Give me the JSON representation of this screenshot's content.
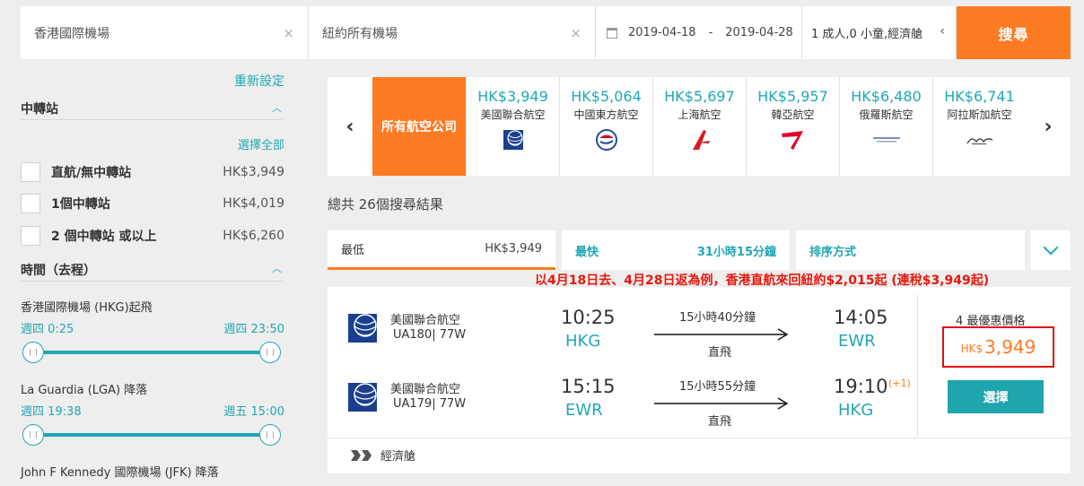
{
  "search": {
    "from": "香港國際機場",
    "to": "紐約所有機場",
    "depart_date": "2019-04-18",
    "date_separator": "-",
    "return_date": "2019-04-28",
    "passengers": "1 成人,0 小童,經濟艙",
    "clear_glyph": "×",
    "search_label": "搜尋"
  },
  "filters": {
    "reset": "重新設定",
    "stops_title": "中轉站",
    "select_all": "選擇全部",
    "stops": [
      {
        "label": "直航/無中轉站",
        "price": "HK$3,949"
      },
      {
        "label": "1個中轉站",
        "price": "HK$4,019"
      },
      {
        "label": "2 個中轉站 或以上",
        "price": "HK$6,260"
      }
    ],
    "time_title": "時間（去程）",
    "departure": {
      "label": "香港國際機場 (HKG)起飛",
      "min": "週四 0:25",
      "max": "週四 23:50"
    },
    "arrival_lga": {
      "label": "La Guardia (LGA) 降落",
      "min": "週四 19:38",
      "max": "週五 15:00"
    },
    "arrival_jfk": {
      "label": "John F Kennedy 國際機場 (JFK) 降落"
    }
  },
  "airlines": {
    "all_label": "所有航空公司",
    "items": [
      {
        "price": "HK$3,949",
        "name": "美國聯合航空",
        "icon": "united-logo-icon"
      },
      {
        "price": "HK$5,064",
        "name": "中國東方航空",
        "icon": "china-eastern-logo-icon"
      },
      {
        "price": "HK$5,697",
        "name": "上海航空",
        "icon": "shanghai-airlines-logo-icon"
      },
      {
        "price": "HK$5,957",
        "name": "韓亞航空",
        "icon": "asiana-logo-icon"
      },
      {
        "price": "HK$6,480",
        "name": "俄羅斯航空",
        "icon": "aeroflot-logo-icon"
      },
      {
        "price": "HK$6,741",
        "name": "阿拉斯加航空",
        "icon": "alaska-logo-icon"
      }
    ],
    "prev": "‹",
    "next": "›"
  },
  "results": {
    "count_text": "總共 26個搜尋結果"
  },
  "sort": {
    "cheapest": {
      "label": "最低",
      "value": "HK$3,949"
    },
    "fastest": {
      "label": "最快",
      "value": "31小時15分鐘"
    },
    "order_label": "排序方式"
  },
  "promo_text": "以4月18日去、4月28日返為例，香港直航來回紐約$2,015起 (連稅$3,949起)",
  "flight": {
    "outbound": {
      "airline": "美國聯合航空",
      "flight": "UA180| 77W",
      "dep_time": "10:25",
      "dep_code": "HKG",
      "duration": "15小時40分鐘",
      "type": "直飛",
      "arr_time": "14:05",
      "arr_code": "EWR"
    },
    "inbound": {
      "airline": "美國聯合航空",
      "flight": "UA179| 77W",
      "dep_time": "15:15",
      "dep_code": "EWR",
      "duration": "15小時55分鐘",
      "type": "直飛",
      "arr_time": "19:10",
      "arr_day_offset": "(+1)",
      "arr_code": "HKG"
    },
    "price_label": "4 最優惠價格",
    "price_currency": "HK$",
    "price_value": "3,949",
    "select_label": "選擇",
    "cabin": "經濟艙"
  },
  "colors": {
    "accent": "#fd7b23",
    "teal": "#20a7b3",
    "promo_red": "#e8180c"
  }
}
